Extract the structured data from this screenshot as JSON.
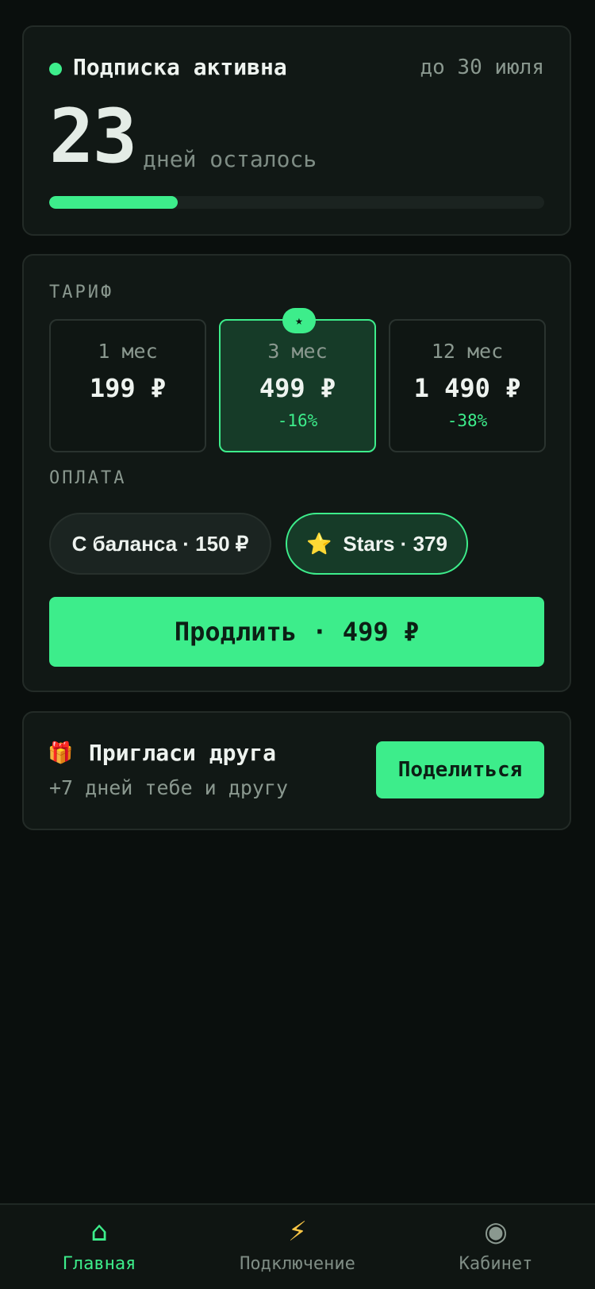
{
  "subscription": {
    "status": "Подписка активна",
    "until": "до 30 июля",
    "days_left": "23",
    "days_label": "дней осталось",
    "progress_fraction": 0.26
  },
  "tariff": {
    "section_label": "ТАРИФ",
    "plans": [
      {
        "period": "1 мес",
        "price": "199 ₽",
        "discount": "",
        "selected": false
      },
      {
        "period": "3 мес",
        "price": "499 ₽",
        "discount": "-16%",
        "selected": true,
        "badge": "★"
      },
      {
        "period": "12 мес",
        "price": "1 490 ₽",
        "discount": "-38%",
        "selected": false
      }
    ]
  },
  "payment": {
    "section_label": "ОПЛАТА",
    "balance_label": "С баланса · 150 ₽",
    "stars_icon": "⭐",
    "stars_label": "Stars · 379",
    "selected": "stars"
  },
  "renew_button": "Продлить · 499 ₽",
  "referral": {
    "icon": "🎁",
    "title": "Пригласи друга",
    "subtitle": "+7 дней тебе и другу",
    "share_button": "Поделиться"
  },
  "nav": {
    "items": [
      {
        "icon": "⌂",
        "label": "Главная",
        "active": true
      },
      {
        "icon": "⚡",
        "label": "Подключение",
        "active": false
      },
      {
        "icon": "◉",
        "label": "Кабинет",
        "active": false
      }
    ]
  },
  "colors": {
    "accent": "#3ded8b",
    "background": "#0a0f0d",
    "card": "#111815"
  }
}
